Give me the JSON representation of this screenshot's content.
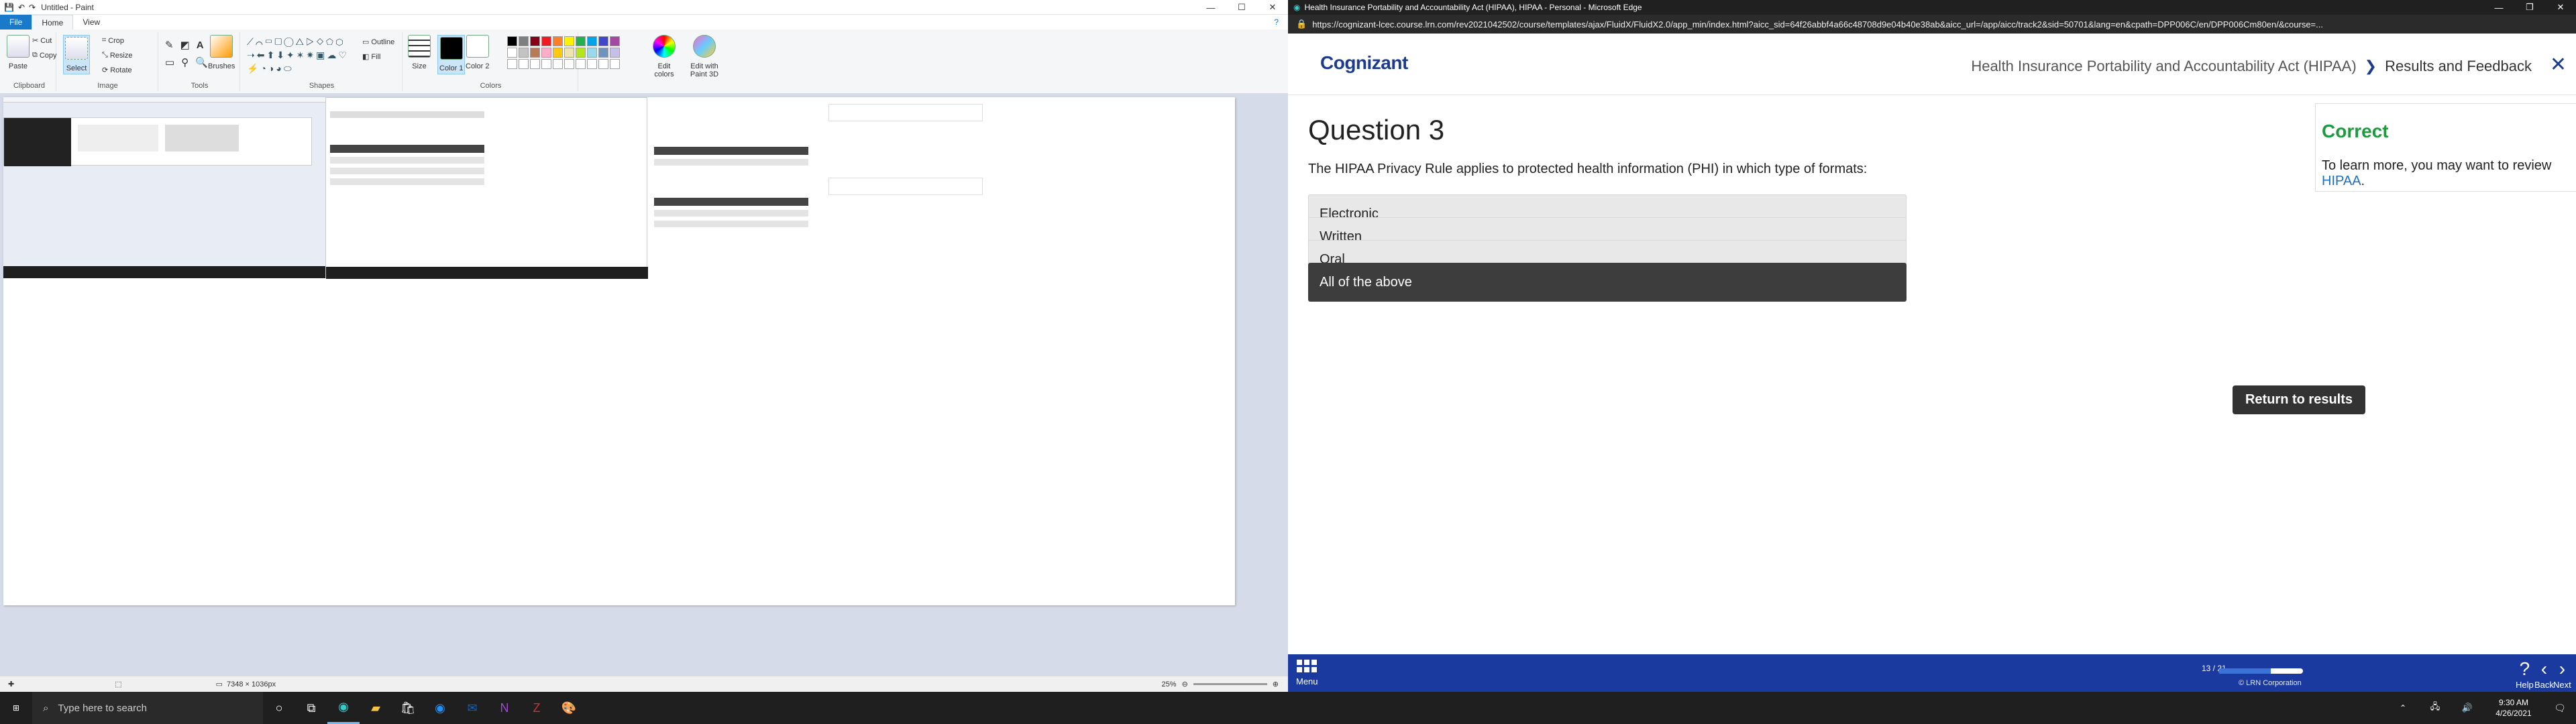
{
  "paint": {
    "title": "Untitled - Paint",
    "menu": {
      "file": "File",
      "home": "Home",
      "view": "View"
    },
    "ribbon": {
      "clipboard": {
        "label": "Clipboard",
        "paste": "Paste",
        "cut": "Cut",
        "copy": "Copy"
      },
      "image": {
        "label": "Image",
        "select": "Select",
        "crop": "Crop",
        "resize": "Resize",
        "rotate": "Rotate"
      },
      "tools": {
        "label": "Tools"
      },
      "brushes": "Brushes",
      "shapes": {
        "label": "Shapes",
        "outline": "Outline",
        "fill": "Fill"
      },
      "size": "Size",
      "color1": "Color 1",
      "color2": "Color 2",
      "colors_label": "Colors",
      "edit_colors": "Edit colors",
      "edit_paint3d": "Edit with Paint 3D",
      "palette": [
        "#000000",
        "#7f7f7f",
        "#880015",
        "#ed1c24",
        "#ff7f27",
        "#fff200",
        "#22b14c",
        "#00a2e8",
        "#3f48cc",
        "#a349a4",
        "#ffffff",
        "#c3c3c3",
        "#b97a57",
        "#ffaec9",
        "#ffc90e",
        "#efe4b0",
        "#b5e61d",
        "#99d9ea",
        "#7092be",
        "#c8bfe7"
      ]
    },
    "status": {
      "dimensions": "7348 × 1036px",
      "zoom": "25%"
    }
  },
  "edge": {
    "title": "Health Insurance Portability and Accountability Act (HIPAA), HIPAA - Personal - Microsoft Edge",
    "url": "https://cognizant-lcec.course.lrn.com/rev2021042502/course/templates/ajax/FluidX/FluidX2.0/app_min/index.html?aicc_sid=64f26abbf4a66c48708d9e04b40e38ab&aicc_url=/app/aicc/track2&sid=50701&lang=en&cpath=DPP006C/en/DPP006Cm80en/&course=...",
    "logo": "Cognizant",
    "breadcrumb": {
      "course": "Health Insurance Portability and Accountability Act (HIPAA)",
      "page": "Results and Feedback"
    },
    "question": {
      "heading": "Question 3",
      "text": "The HIPAA Privacy Rule applies to protected health information (PHI) in which type of formats:",
      "options": [
        "Electronic",
        "Written",
        "Oral",
        "All of the above"
      ]
    },
    "return_button": "Return to results",
    "feedback": {
      "heading": "Correct",
      "text": "To learn more, you may want to review ",
      "link": "HIPAA",
      "end": "."
    },
    "footer": {
      "menu": "Menu",
      "progress_text": "13 / 21",
      "progress": 0.62,
      "copyright": "© LRN Corporation",
      "help": "Help",
      "back": "Back",
      "next": "Next"
    }
  },
  "taskbar": {
    "search_placeholder": "Type here to search",
    "time": "9:30 AM",
    "date": "4/26/2021"
  }
}
